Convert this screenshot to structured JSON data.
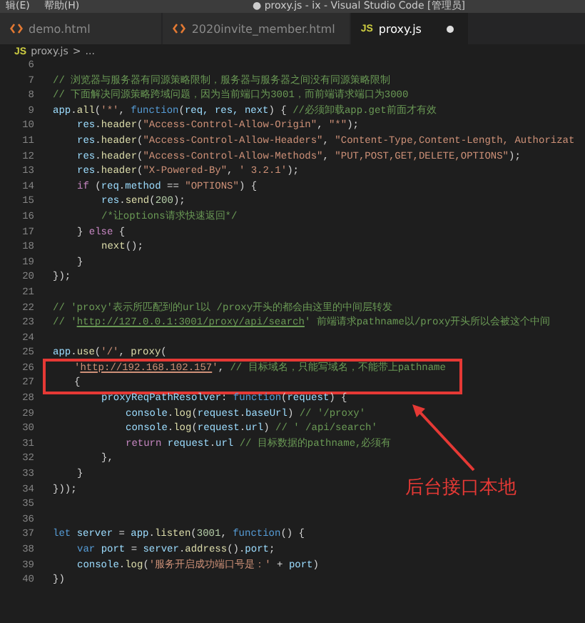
{
  "menu": [
    "辑(E)",
    "帮助(H)"
  ],
  "window": {
    "title": "● proxy.js - ix - Visual Studio Code [管理员]"
  },
  "tabs": [
    {
      "label": "demo.html",
      "kind": "html",
      "selected": false,
      "modified": false
    },
    {
      "label": "2020invite_member.html",
      "kind": "html",
      "selected": false,
      "modified": false
    },
    {
      "label": "proxy.js",
      "kind": "js",
      "icon_label": "JS",
      "selected": true,
      "modified": true
    }
  ],
  "breadcrumb": {
    "icon_label": "JS",
    "file": "proxy.js",
    "separator": ">",
    "rest": "..."
  },
  "lines": [
    {
      "number": "6"
    },
    {
      "number": "7",
      "tokens": [
        {
          "kind": "comment",
          "text": "// 浏览器与服务器有同源策略限制，服务器与服务器之间没有同源策略限制"
        }
      ]
    },
    {
      "number": "8",
      "tokens": [
        {
          "kind": "comment",
          "text": "// 下面解决同源策略跨域问题，因为当前端口为3001，而前端请求端口为3000"
        }
      ]
    },
    {
      "number": "9",
      "tokens": [
        {
          "kind": "var",
          "text": "app"
        },
        {
          "kind": "plain",
          "text": "."
        },
        {
          "kind": "fn",
          "text": "all"
        },
        {
          "kind": "plain",
          "text": "("
        },
        {
          "kind": "str",
          "text": "'*'"
        },
        {
          "kind": "plain",
          "text": ", "
        },
        {
          "kind": "kw",
          "text": "function"
        },
        {
          "kind": "plain",
          "text": "("
        },
        {
          "kind": "var",
          "text": "req, res, next"
        },
        {
          "kind": "plain",
          "text": ") { "
        },
        {
          "kind": "comment",
          "text": "//必须卸载app.get前面才有效"
        }
      ],
      "children": [
        {
          "number": "10",
          "tokens": [
            {
              "kind": "var",
              "text": "res"
            },
            {
              "kind": "plain",
              "text": "."
            },
            {
              "kind": "fn",
              "text": "header"
            },
            {
              "kind": "plain",
              "text": "("
            },
            {
              "kind": "str",
              "text": "\"Access-Control-Allow-Origin\""
            },
            {
              "kind": "plain",
              "text": ", "
            },
            {
              "kind": "str",
              "text": "\"*\""
            },
            {
              "kind": "plain",
              "text": ");"
            }
          ]
        },
        {
          "number": "11",
          "tokens": [
            {
              "kind": "var",
              "text": "res"
            },
            {
              "kind": "plain",
              "text": "."
            },
            {
              "kind": "fn",
              "text": "header"
            },
            {
              "kind": "plain",
              "text": "("
            },
            {
              "kind": "str",
              "text": "\"Access-Control-Allow-Headers\""
            },
            {
              "kind": "plain",
              "text": ", "
            },
            {
              "kind": "str",
              "text": "\"Content-Type,Content-Length, Authorizat"
            }
          ]
        },
        {
          "number": "12",
          "tokens": [
            {
              "kind": "var",
              "text": "res"
            },
            {
              "kind": "plain",
              "text": "."
            },
            {
              "kind": "fn",
              "text": "header"
            },
            {
              "kind": "plain",
              "text": "("
            },
            {
              "kind": "str",
              "text": "\"Access-Control-Allow-Methods\""
            },
            {
              "kind": "plain",
              "text": ", "
            },
            {
              "kind": "str",
              "text": "\"PUT,POST,GET,DELETE,OPTIONS\""
            },
            {
              "kind": "plain",
              "text": ");"
            }
          ]
        },
        {
          "number": "13",
          "tokens": [
            {
              "kind": "var",
              "text": "res"
            },
            {
              "kind": "plain",
              "text": "."
            },
            {
              "kind": "fn",
              "text": "header"
            },
            {
              "kind": "plain",
              "text": "("
            },
            {
              "kind": "str",
              "text": "\"X-Powered-By\""
            },
            {
              "kind": "plain",
              "text": ", "
            },
            {
              "kind": "str",
              "text": "' 3.2.1'"
            },
            {
              "kind": "plain",
              "text": ");"
            }
          ]
        },
        {
          "number": "14",
          "tokens": [
            {
              "kind": "ctl",
              "text": "if"
            },
            {
              "kind": "plain",
              "text": " ("
            },
            {
              "kind": "var",
              "text": "req"
            },
            {
              "kind": "plain",
              "text": "."
            },
            {
              "kind": "var",
              "text": "method"
            },
            {
              "kind": "plain",
              "text": " == "
            },
            {
              "kind": "str",
              "text": "\"OPTIONS\""
            },
            {
              "kind": "plain",
              "text": ") {"
            }
          ],
          "children": [
            {
              "number": "15",
              "tokens": [
                {
                  "kind": "var",
                  "text": "res"
                },
                {
                  "kind": "plain",
                  "text": "."
                },
                {
                  "kind": "fn",
                  "text": "send"
                },
                {
                  "kind": "plain",
                  "text": "("
                },
                {
                  "kind": "num",
                  "text": "200"
                },
                {
                  "kind": "plain",
                  "text": ");"
                }
              ]
            },
            {
              "number": "16",
              "tokens": [
                {
                  "kind": "comment",
                  "text": "/*让options请求快速返回*/"
                }
              ]
            }
          ]
        },
        {
          "number": "17",
          "tokens": [
            {
              "kind": "plain",
              "text": "} "
            },
            {
              "kind": "ctl",
              "text": "else"
            },
            {
              "kind": "plain",
              "text": " {"
            }
          ],
          "children": [
            {
              "number": "18",
              "tokens": [
                {
                  "kind": "fn",
                  "text": "next"
                },
                {
                  "kind": "plain",
                  "text": "();"
                }
              ]
            }
          ]
        },
        {
          "number": "19",
          "tokens": [
            {
              "kind": "plain",
              "text": "}"
            }
          ]
        }
      ]
    },
    {
      "number": "20",
      "tokens": [
        {
          "kind": "plain",
          "text": "});"
        }
      ]
    },
    {
      "number": "21"
    },
    {
      "number": "22",
      "tokens": [
        {
          "kind": "comment",
          "text": "// 'proxy'表示所匹配到的url以 /proxy开头的都会由这里的中间层转发"
        }
      ]
    },
    {
      "number": "23",
      "tokens": [
        {
          "kind": "comment",
          "text": "// '"
        },
        {
          "kind": "comment_link",
          "text": "http://127.0.0.1:3001/proxy/api/search"
        },
        {
          "kind": "comment",
          "text": "' 前端请求pathname以/proxy开头所以会被这个中间"
        }
      ]
    },
    {
      "number": "24"
    },
    {
      "number": "25",
      "tokens": [
        {
          "kind": "var",
          "text": "app"
        },
        {
          "kind": "plain",
          "text": "."
        },
        {
          "kind": "fn",
          "text": "use"
        },
        {
          "kind": "plain",
          "text": "("
        },
        {
          "kind": "str",
          "text": "'/'"
        },
        {
          "kind": "plain",
          "text": ", "
        },
        {
          "kind": "fn",
          "text": "proxy"
        },
        {
          "kind": "plain",
          "text": "("
        }
      ],
      "children": [
        {
          "number": "26",
          "boxed": true,
          "tokens": [
            {
              "kind": "str",
              "text": "'"
            },
            {
              "kind": "str_link",
              "text": "http://192.168.102.157"
            },
            {
              "kind": "str",
              "text": "'"
            },
            {
              "kind": "plain",
              "text": ", "
            },
            {
              "kind": "comment",
              "text": "// 目标域名，只能写域名，不能带上pathname"
            }
          ]
        },
        {
          "number": "27",
          "boxed": true,
          "tokens": [
            {
              "kind": "plain",
              "text": "{"
            }
          ],
          "children": [
            {
              "number": "28",
              "tokens": [
                {
                  "kind": "var",
                  "text": "proxyReqPathResolver"
                },
                {
                  "kind": "plain",
                  "text": ": "
                },
                {
                  "kind": "kw",
                  "text": "function"
                },
                {
                  "kind": "plain",
                  "text": "("
                },
                {
                  "kind": "var",
                  "text": "request"
                },
                {
                  "kind": "plain",
                  "text": ") {"
                }
              ],
              "children": [
                {
                  "number": "29",
                  "tokens": [
                    {
                      "kind": "var",
                      "text": "console"
                    },
                    {
                      "kind": "plain",
                      "text": "."
                    },
                    {
                      "kind": "fn",
                      "text": "log"
                    },
                    {
                      "kind": "plain",
                      "text": "("
                    },
                    {
                      "kind": "var",
                      "text": "request"
                    },
                    {
                      "kind": "plain",
                      "text": "."
                    },
                    {
                      "kind": "var",
                      "text": "baseUrl"
                    },
                    {
                      "kind": "plain",
                      "text": ") "
                    },
                    {
                      "kind": "comment",
                      "text": "// '/proxy'"
                    }
                  ]
                },
                {
                  "number": "30",
                  "tokens": [
                    {
                      "kind": "var",
                      "text": "console"
                    },
                    {
                      "kind": "plain",
                      "text": "."
                    },
                    {
                      "kind": "fn",
                      "text": "log"
                    },
                    {
                      "kind": "plain",
                      "text": "("
                    },
                    {
                      "kind": "var",
                      "text": "request"
                    },
                    {
                      "kind": "plain",
                      "text": "."
                    },
                    {
                      "kind": "var",
                      "text": "url"
                    },
                    {
                      "kind": "plain",
                      "text": ") "
                    },
                    {
                      "kind": "comment",
                      "text": "// ' /api/search'"
                    }
                  ]
                },
                {
                  "number": "31",
                  "tokens": [
                    {
                      "kind": "ctl",
                      "text": "return "
                    },
                    {
                      "kind": "var",
                      "text": "request"
                    },
                    {
                      "kind": "plain",
                      "text": "."
                    },
                    {
                      "kind": "var",
                      "text": "url "
                    },
                    {
                      "kind": "comment",
                      "text": "// 目标数据的pathname,必须有"
                    }
                  ]
                }
              ]
            },
            {
              "number": "32",
              "tokens": [
                {
                  "kind": "plain",
                  "text": "},"
                }
              ]
            }
          ]
        },
        {
          "number": "33",
          "tokens": [
            {
              "kind": "plain",
              "text": "}"
            }
          ]
        }
      ]
    },
    {
      "number": "34",
      "tokens": [
        {
          "kind": "plain",
          "text": "}));"
        }
      ]
    },
    {
      "number": "35"
    },
    {
      "number": "36"
    },
    {
      "number": "37",
      "tokens": [
        {
          "kind": "kw",
          "text": "let "
        },
        {
          "kind": "var",
          "text": "server"
        },
        {
          "kind": "plain",
          "text": " = "
        },
        {
          "kind": "var",
          "text": "app"
        },
        {
          "kind": "plain",
          "text": "."
        },
        {
          "kind": "fn",
          "text": "listen"
        },
        {
          "kind": "plain",
          "text": "("
        },
        {
          "kind": "num",
          "text": "3001"
        },
        {
          "kind": "plain",
          "text": ", "
        },
        {
          "kind": "kw",
          "text": "function"
        },
        {
          "kind": "plain",
          "text": "() {"
        }
      ],
      "children": [
        {
          "number": "38",
          "tokens": [
            {
              "kind": "kw",
              "text": "var "
            },
            {
              "kind": "var",
              "text": "port"
            },
            {
              "kind": "plain",
              "text": " = "
            },
            {
              "kind": "var",
              "text": "server"
            },
            {
              "kind": "plain",
              "text": "."
            },
            {
              "kind": "fn",
              "text": "address"
            },
            {
              "kind": "plain",
              "text": "()."
            },
            {
              "kind": "var",
              "text": "port"
            },
            {
              "kind": "plain",
              "text": ";"
            }
          ]
        },
        {
          "number": "39",
          "tokens": [
            {
              "kind": "var",
              "text": "console"
            },
            {
              "kind": "plain",
              "text": "."
            },
            {
              "kind": "fn",
              "text": "log"
            },
            {
              "kind": "plain",
              "text": "("
            },
            {
              "kind": "str",
              "text": "'服务开启成功端口号是：'"
            },
            {
              "kind": "plain",
              "text": " + "
            },
            {
              "kind": "var",
              "text": "port"
            },
            {
              "kind": "plain",
              "text": ")"
            }
          ]
        }
      ]
    },
    {
      "number": "40",
      "tokens": [
        {
          "kind": "plain",
          "text": "})"
        }
      ]
    }
  ],
  "annotation": {
    "text": "后台接口本地"
  }
}
